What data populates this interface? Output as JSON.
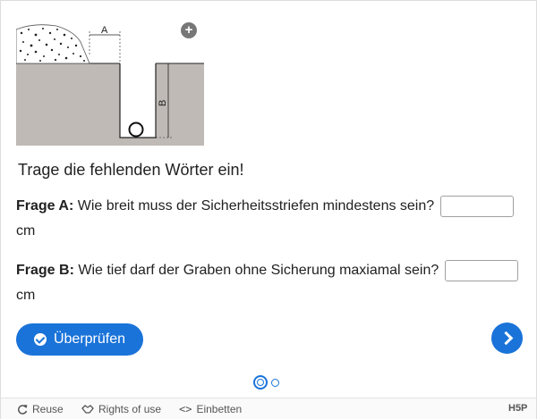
{
  "illustration": {
    "label_a": "A",
    "label_b": "B"
  },
  "task": "Trage die fehlenden Wörter ein!",
  "questions": [
    {
      "label": "Frage A:",
      "text": "Wie breit muss der Sicherheitsstriefen mindestens sein?",
      "unit": "cm",
      "value": ""
    },
    {
      "label": "Frage B:",
      "text": "Wie tief darf der Graben ohne Sicherung maxiamal sein?",
      "unit": "cm",
      "value": ""
    }
  ],
  "buttons": {
    "check": "Überprüfen"
  },
  "footer": {
    "reuse": "Reuse",
    "rights": "Rights of use",
    "embed": "Einbetten",
    "brand": "H5P"
  },
  "colors": {
    "accent": "#1a73d9",
    "ground": "#bfbab6"
  }
}
